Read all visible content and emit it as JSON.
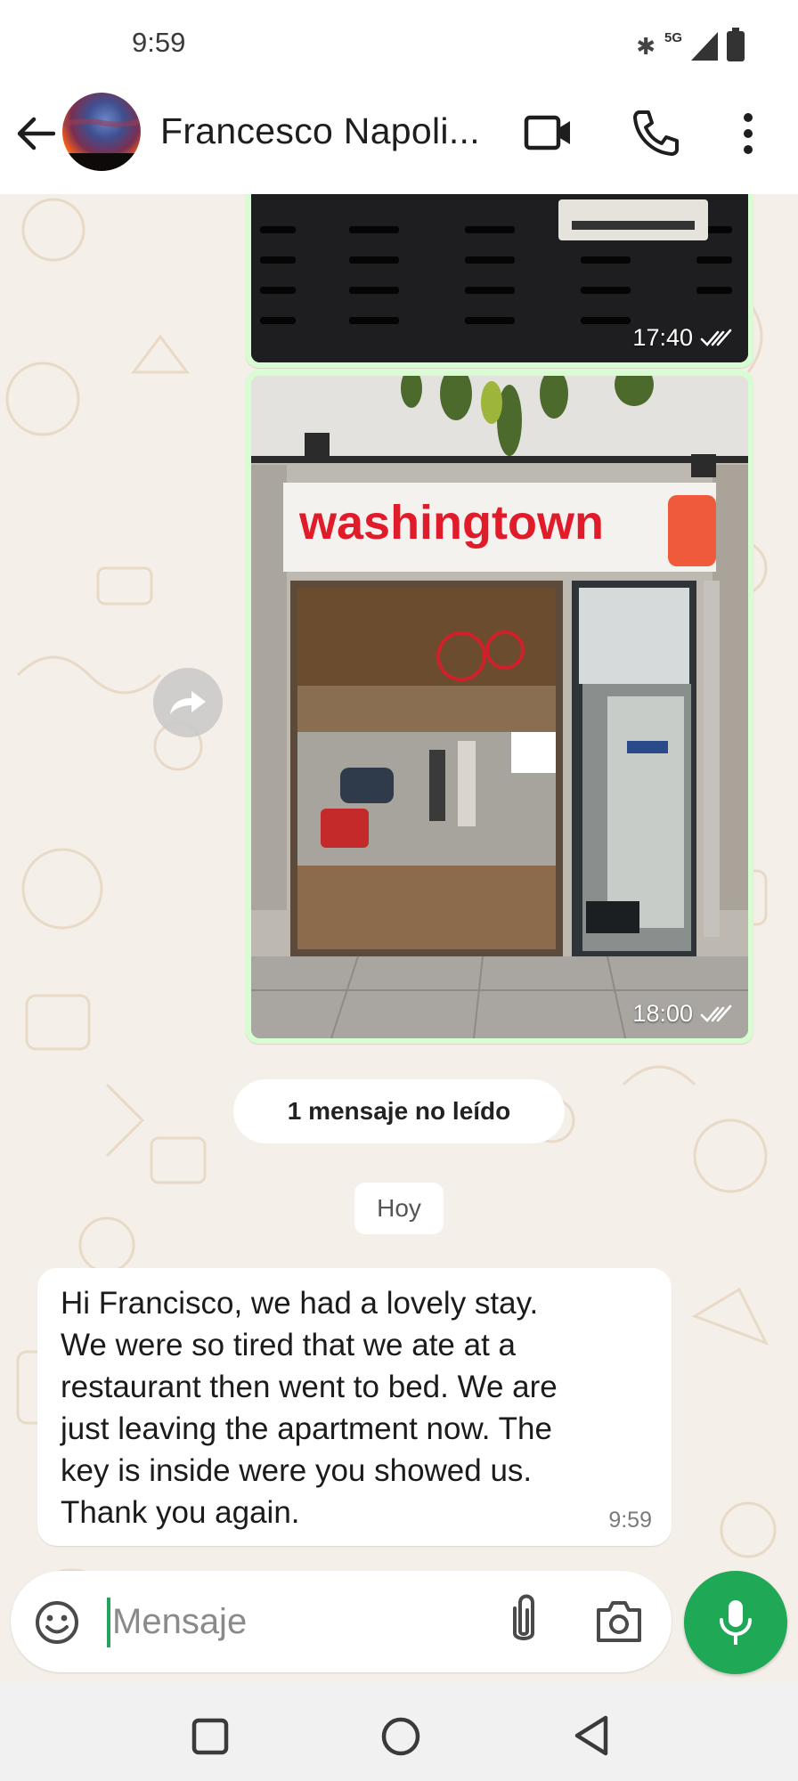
{
  "status_bar": {
    "time": "9:59",
    "network": "5G",
    "icons": [
      "bluetooth-icon",
      "signal-icon",
      "battery-icon"
    ]
  },
  "header": {
    "contact_name": "Francesco Napoli...",
    "icons": [
      "back-arrow-icon",
      "video-camera-icon",
      "phone-icon",
      "more-vertical-icon"
    ]
  },
  "messages": [
    {
      "type": "image",
      "time": "17:40",
      "status": "read"
    },
    {
      "type": "image",
      "time": "18:00",
      "status": "read",
      "sign_text": "washingtown"
    }
  ],
  "unread_banner": "1 mensaje no leído",
  "date_divider": "Hoy",
  "incoming_message": {
    "lines": [
      "Hi Francisco, we had a lovely stay.",
      "We were so tired that we ate at a",
      "restaurant then went to bed. We are",
      "just leaving the apartment now. The",
      "key is inside were you showed us.",
      "Thank you again."
    ],
    "time": "9:59"
  },
  "composer": {
    "placeholder": "Mensaje",
    "icons": [
      "emoji-icon",
      "paperclip-icon",
      "camera-icon",
      "microphone-icon"
    ]
  },
  "nav": {
    "icons": [
      "square-recents-icon",
      "circle-home-icon",
      "triangle-back-icon"
    ]
  },
  "colors": {
    "accent_green": "#1fa855",
    "outgoing_bubble": "#d9fdd3",
    "chat_background": "#f4efe8",
    "sign_red": "#e11c2a"
  }
}
